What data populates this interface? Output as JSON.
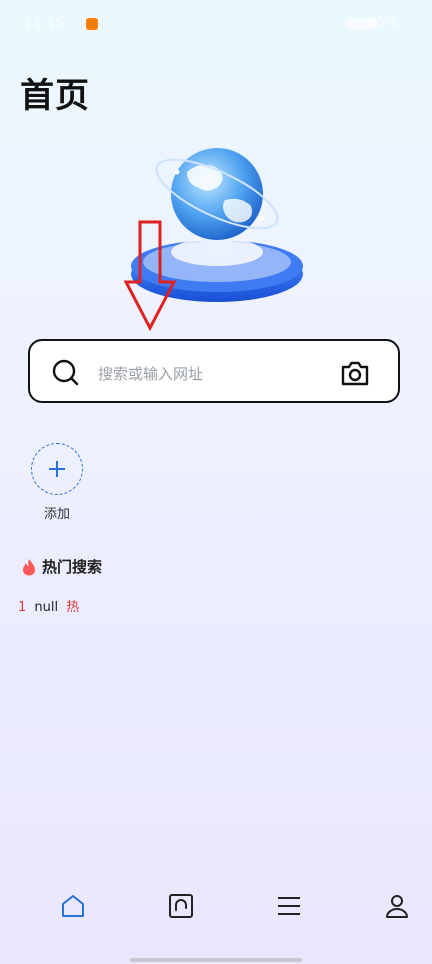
{
  "status_bar": {
    "time": "11:15",
    "battery": "45%"
  },
  "page": {
    "title": "首页"
  },
  "search": {
    "placeholder": "搜索或输入网址"
  },
  "shortcuts": {
    "add_label": "添加"
  },
  "hot_search": {
    "title": "热门搜索",
    "items": [
      {
        "rank": "1",
        "text": "null",
        "tag": "热"
      }
    ]
  },
  "colors": {
    "accent": "#2a73d6",
    "hot": "#e53935",
    "annotation": "#e02020"
  },
  "bottom_nav": {
    "items": [
      {
        "icon": "home-icon",
        "active": true
      },
      {
        "icon": "tabs-icon",
        "active": false
      },
      {
        "icon": "menu-icon",
        "active": false
      },
      {
        "icon": "profile-icon",
        "active": false
      }
    ]
  }
}
